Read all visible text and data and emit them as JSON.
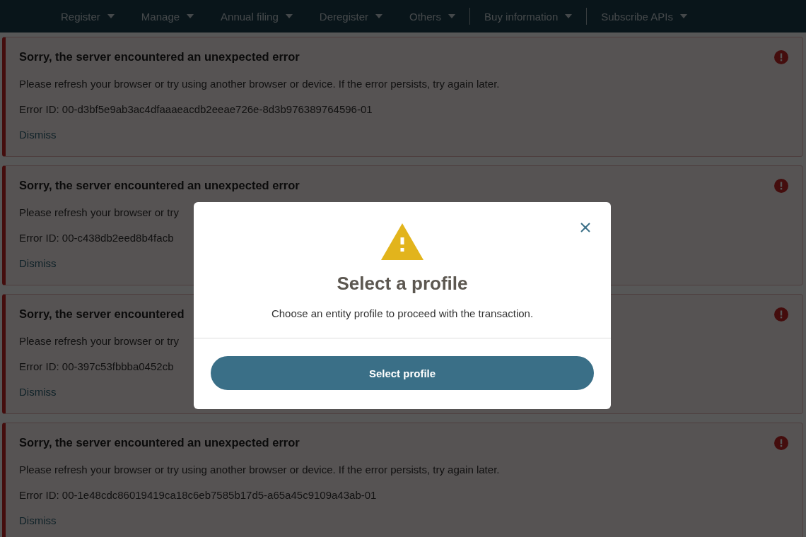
{
  "nav": {
    "items": [
      {
        "label": "Register",
        "divider_before": false
      },
      {
        "label": "Manage",
        "divider_before": false
      },
      {
        "label": "Annual filing",
        "divider_before": false
      },
      {
        "label": "Deregister",
        "divider_before": false
      },
      {
        "label": "Others",
        "divider_before": false
      },
      {
        "label": "Buy information",
        "divider_before": true
      },
      {
        "label": "Subscribe APIs",
        "divider_before": true
      }
    ]
  },
  "alerts": [
    {
      "title": "Sorry, the server encountered an unexpected error",
      "message": "Please refresh your browser or try using another browser or device. If the error persists, try again later.",
      "error_id": "Error ID: 00-d3bf5e9ab3ac4dfaaaeacdb2eeae726e-8d3b976389764596-01",
      "dismiss": "Dismiss"
    },
    {
      "title": "Sorry, the server encountered an unexpected error",
      "message": "Please refresh your browser or try",
      "error_id": "Error ID: 00-c438db2eed8b4facb",
      "dismiss": "Dismiss"
    },
    {
      "title": "Sorry, the server encountered",
      "message": "Please refresh your browser or try",
      "error_id": "Error ID: 00-397c53fbbba0452cb",
      "dismiss": "Dismiss"
    },
    {
      "title": "Sorry, the server encountered an unexpected error",
      "message": "Please refresh your browser or try using another browser or device. If the error persists, try again later.",
      "error_id": "Error ID: 00-1e48cdc86019419ca18c6eb7585b17d5-a65a45c9109a43ab-01",
      "dismiss": "Dismiss"
    }
  ],
  "modal": {
    "title": "Select a profile",
    "message": "Choose an entity profile to proceed with the transaction.",
    "button": "Select profile"
  }
}
